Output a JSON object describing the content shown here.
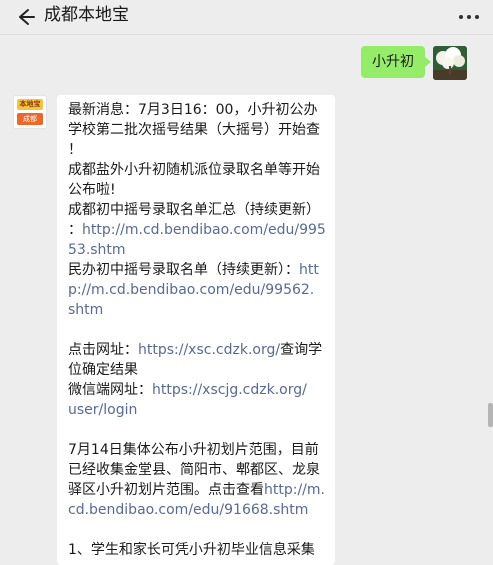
{
  "header": {
    "title": "成都本地宝",
    "back_icon": "back-arrow-icon",
    "more_icon": "more-dots-icon"
  },
  "outgoing": {
    "text": "小升初",
    "bubble_color": "#95ec69"
  },
  "incoming": {
    "avatar_top": "本地宝",
    "avatar_bottom": "成都",
    "lines": {
      "l1": "最新消息：7月3日16：00，小升初公办",
      "l2": "学校第二批次摇号结果（大摇号）开始查",
      "l3": "！",
      "l4": "成都盐外小升初随机派位录取名单等开始",
      "l5": "公布啦!",
      "l6": "成都初中摇号录取名单汇总（持续更新）",
      "l7a": "：",
      "l7b": "http://m.cd.bendibao.com/edu/995",
      "l8": "53.shtm",
      "l9a": "民办初中摇号录取名单（持续更新）：",
      "l9b": "htt",
      "l10": "p://m.cd.bendibao.com/edu/99562.",
      "l11": "shtm",
      "l12a": "点击网址：",
      "l12b": "https://xsc.cdzk.org/",
      "l12c": "查询学",
      "l13": "位确定结果",
      "l14a": "微信端网址：",
      "l14b": "https://xscjg.cdzk.org/",
      "l15": "user/login",
      "l16": "7月14日集体公布小升初划片范围，目前",
      "l17": "已经收集金堂县、简阳市、郫都区、龙泉",
      "l18a": "驿区小升初划片范围。点击查看",
      "l18b": "http://m.",
      "l19": "cd.bendibao.com/edu/91668.shtm",
      "l20": "1、学生和家长可凭小升初毕业信息采集"
    },
    "link_color": "#576b95"
  }
}
